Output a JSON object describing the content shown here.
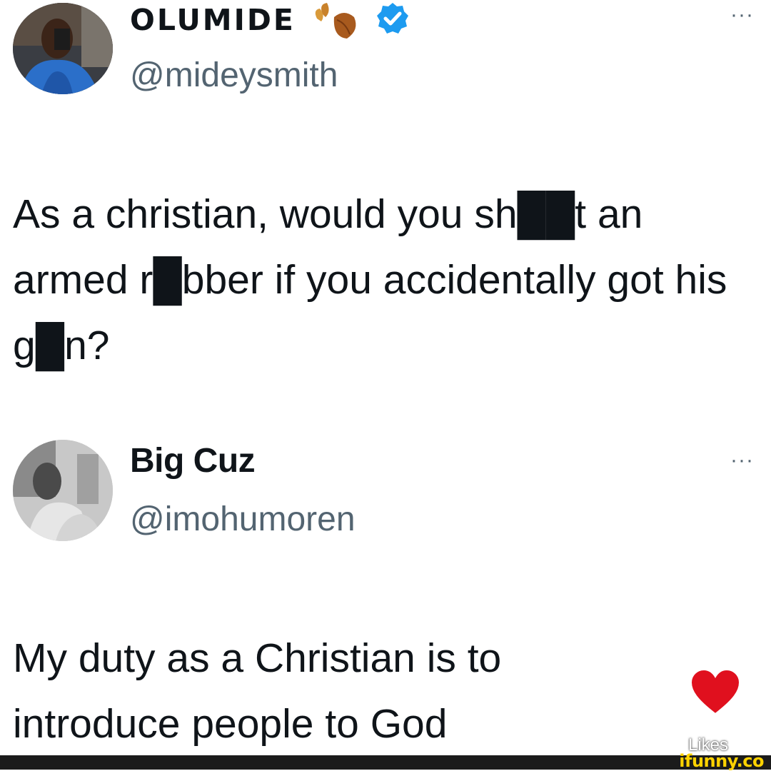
{
  "tweets": [
    {
      "name": "OLUMIDE",
      "handle": "@mideysmith",
      "text": "As a christian, would you sh██t an armed r█bber if you accidentally got his g█n?",
      "badges": [
        "leaf-emoji",
        "verified-badge"
      ],
      "more_label": "···"
    },
    {
      "name": "Big Cuz",
      "handle": "@imohumoren",
      "text": "My duty as a Christian is to introduce people to God",
      "more_label": "···"
    }
  ],
  "overlay": {
    "likes_label": "Likes",
    "watermark": "ifunny.co",
    "heart_color": "#e0101e"
  },
  "colors": {
    "handle": "#536471",
    "verified": "#1d9bf0",
    "text": "#0f1419"
  }
}
